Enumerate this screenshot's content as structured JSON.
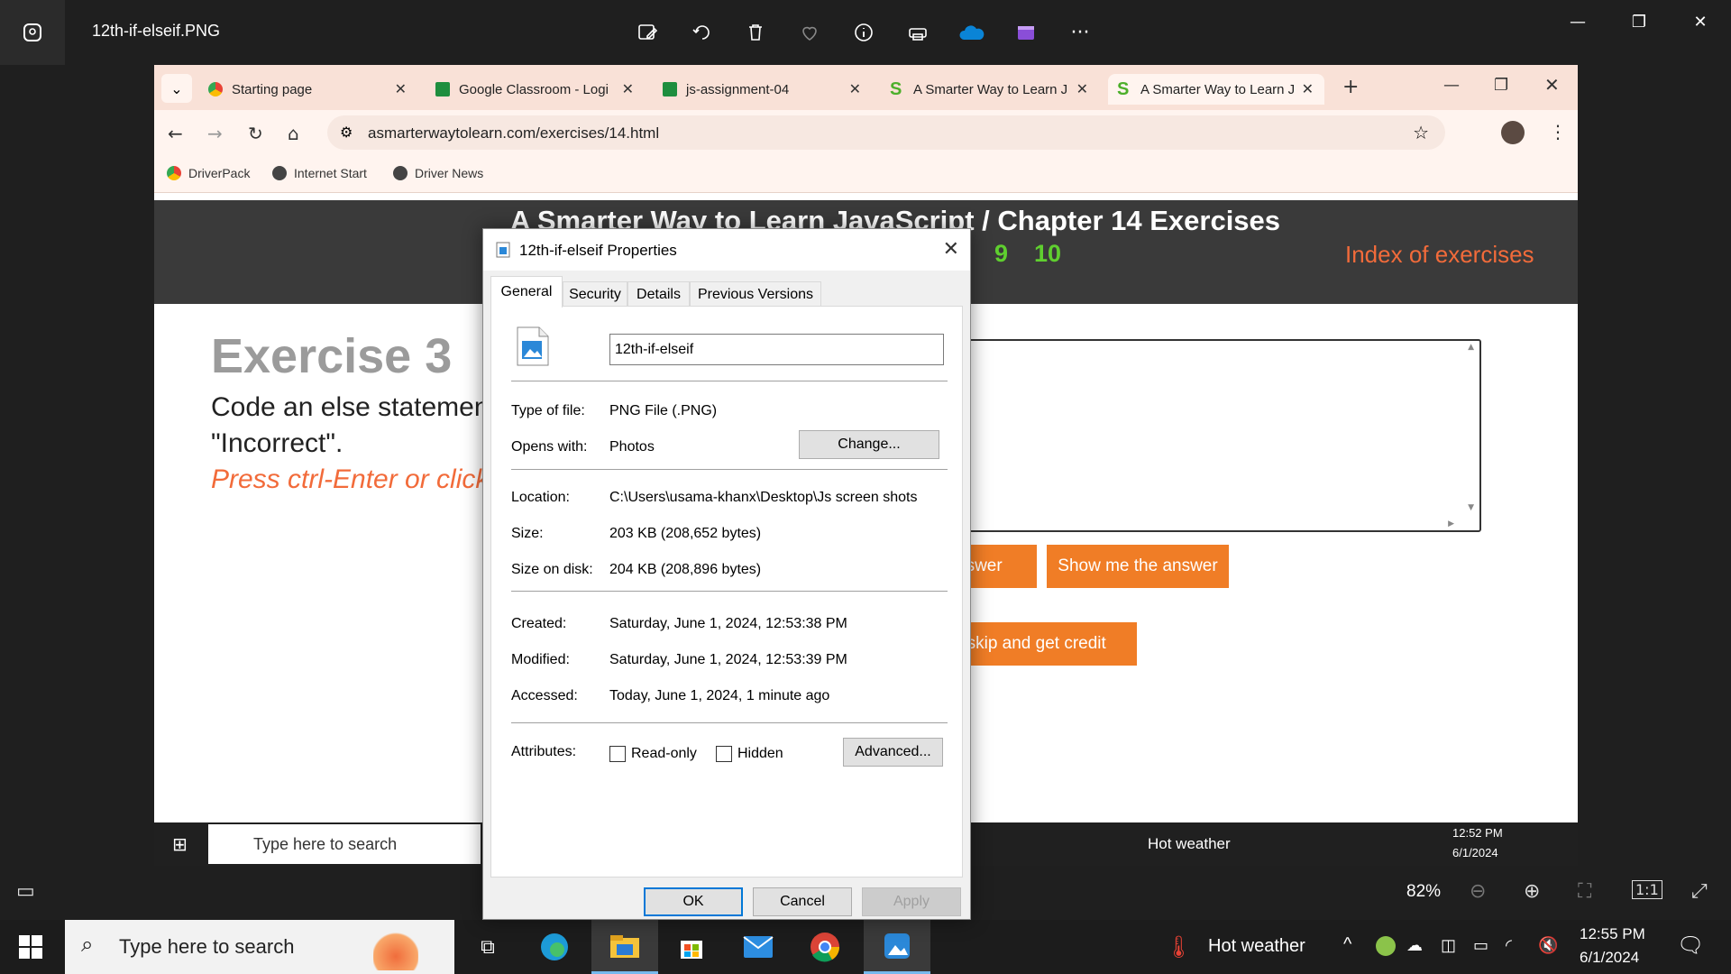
{
  "photos": {
    "file_title": "12th-if-elseif.PNG",
    "zoom": "82%"
  },
  "browser": {
    "tabs": [
      {
        "label": "Starting page"
      },
      {
        "label": "Google Classroom - Logi"
      },
      {
        "label": "js-assignment-04"
      },
      {
        "label": "A Smarter Way to Learn J"
      },
      {
        "label": "A Smarter Way to Learn J"
      }
    ],
    "url": "asmarterwaytolearn.com/exercises/14.html",
    "bookmarks": [
      "DriverPack",
      "Internet Start",
      "Driver News"
    ]
  },
  "page": {
    "heading": "A Smarter Way to Learn JavaScript / Chapter 14 Exercises",
    "nums": [
      "9",
      "10"
    ],
    "index_link": "Index of exercises",
    "exercise_title": "Exercise 3",
    "exercise_desc_1": "Code an else statemen",
    "exercise_desc_2": "\"Incorrect\".",
    "exercise_hint": "Press ctrl-Enter or click b",
    "btn_answer_partial": "nswer",
    "btn_show_answer": "Show me the answer",
    "btn_skip": "- skip and get credit"
  },
  "inner_taskbar": {
    "search": "Type here to search",
    "weather": "Hot weather",
    "time": "12:52 PM",
    "date": "6/1/2024"
  },
  "taskbar": {
    "search": "Type here to search",
    "weather": "Hot weather",
    "time": "12:55 PM",
    "date": "6/1/2024"
  },
  "dialog": {
    "title": "12th-if-elseif Properties",
    "tabs": [
      "General",
      "Security",
      "Details",
      "Previous Versions"
    ],
    "filename": "12th-if-elseif",
    "type_label": "Type of file:",
    "type_value": "PNG File (.PNG)",
    "opens_label": "Opens with:",
    "opens_value": "Photos",
    "change_btn": "Change...",
    "location_label": "Location:",
    "location_value": "C:\\Users\\usama-khanx\\Desktop\\Js screen shots",
    "size_label": "Size:",
    "size_value": "203 KB (208,652 bytes)",
    "disk_label": "Size on disk:",
    "disk_value": "204 KB (208,896 bytes)",
    "created_label": "Created:",
    "created_value": "Saturday, June 1, 2024, 12:53:38 PM",
    "modified_label": "Modified:",
    "modified_value": "Saturday, June 1, 2024, 12:53:39 PM",
    "accessed_label": "Accessed:",
    "accessed_value": "Today, June 1, 2024, 1 minute ago",
    "attributes_label": "Attributes:",
    "readonly_label": "Read-only",
    "hidden_label": "Hidden",
    "advanced_btn": "Advanced...",
    "ok_btn": "OK",
    "cancel_btn": "Cancel",
    "apply_btn": "Apply"
  }
}
